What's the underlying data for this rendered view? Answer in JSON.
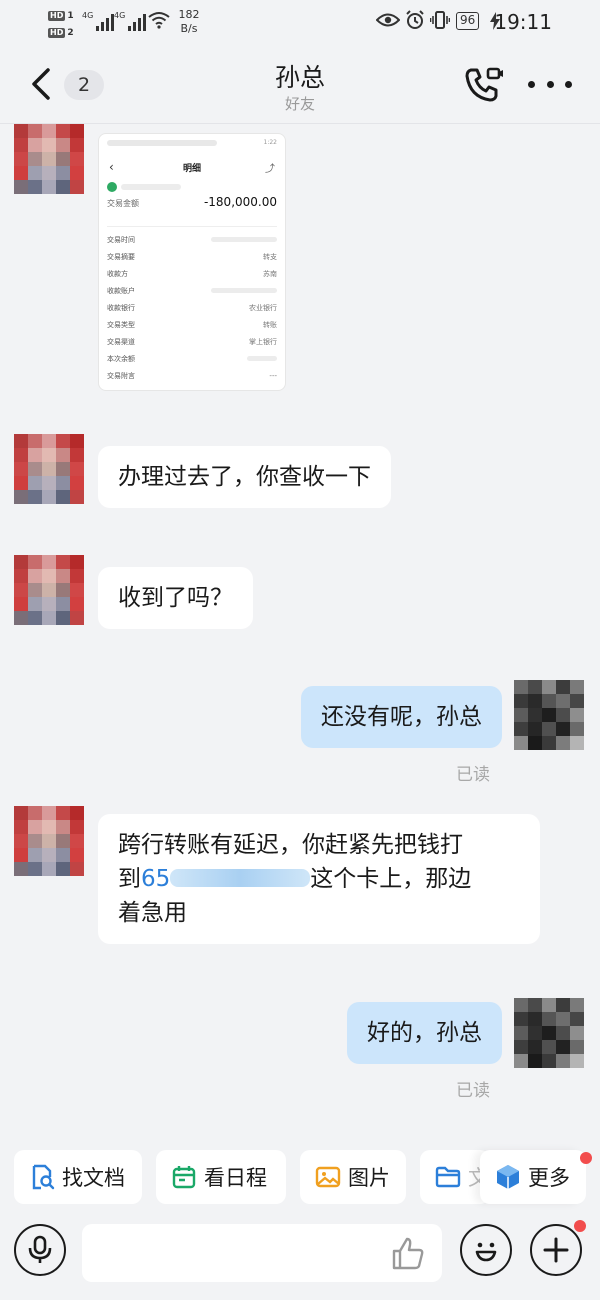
{
  "status_bar": {
    "hd1": "HD",
    "hd1_num": "1",
    "hd2": "HD",
    "hd2_num": "2",
    "sim1_gen": "4G",
    "sim2_gen": "4G",
    "net_speed_value": "182",
    "net_speed_unit": "B/s",
    "battery": "96",
    "time": "19:11"
  },
  "header": {
    "unread_count": "2",
    "title": "孙总",
    "subtitle": "好友"
  },
  "receipt": {
    "nav_title": "明细",
    "status_time": "1:22",
    "amount_label": "交易金额",
    "amount": "-180,000.00",
    "rows": [
      {
        "key": "交易时间",
        "value": ""
      },
      {
        "key": "交易摘要",
        "value": "转支"
      },
      {
        "key": "收款方",
        "value": "苏南"
      },
      {
        "key": "收款账户",
        "value": ""
      },
      {
        "key": "收款银行",
        "value": "农业银行"
      },
      {
        "key": "交易类型",
        "value": "转账"
      },
      {
        "key": "交易渠道",
        "value": "掌上银行"
      },
      {
        "key": "本次余额",
        "value": ""
      },
      {
        "key": "交易附言",
        "value": "---"
      }
    ]
  },
  "messages": {
    "m1": "办理过去了，你查收一下",
    "m2": "收到了吗？",
    "m3": "还没有呢，孙总",
    "m3_status": "已读",
    "m4_part1": "跨行转账有延迟，你赶紧先把钱打",
    "m4_part2_prefix": "到",
    "m4_account": "65",
    "m4_part2_suffix": "这个卡上，那边",
    "m4_part3": "着急用",
    "m5": "好的，孙总",
    "m5_status": "已读"
  },
  "quick_actions": [
    {
      "label": "找文档",
      "icon": "doc-search-icon"
    },
    {
      "label": "看日程",
      "icon": "calendar-icon"
    },
    {
      "label": "图片",
      "icon": "image-icon"
    },
    {
      "label": "文",
      "icon": "folder-icon"
    },
    {
      "label": "更多",
      "icon": "cube-icon"
    }
  ],
  "input": {
    "placeholder": ""
  },
  "colors": {
    "background": "#f2f3f5",
    "outgoing_bubble": "#cce5fb",
    "incoming_bubble": "#ffffff",
    "badge_red": "#f24d4d",
    "link_blue": "#2c7fd9"
  }
}
